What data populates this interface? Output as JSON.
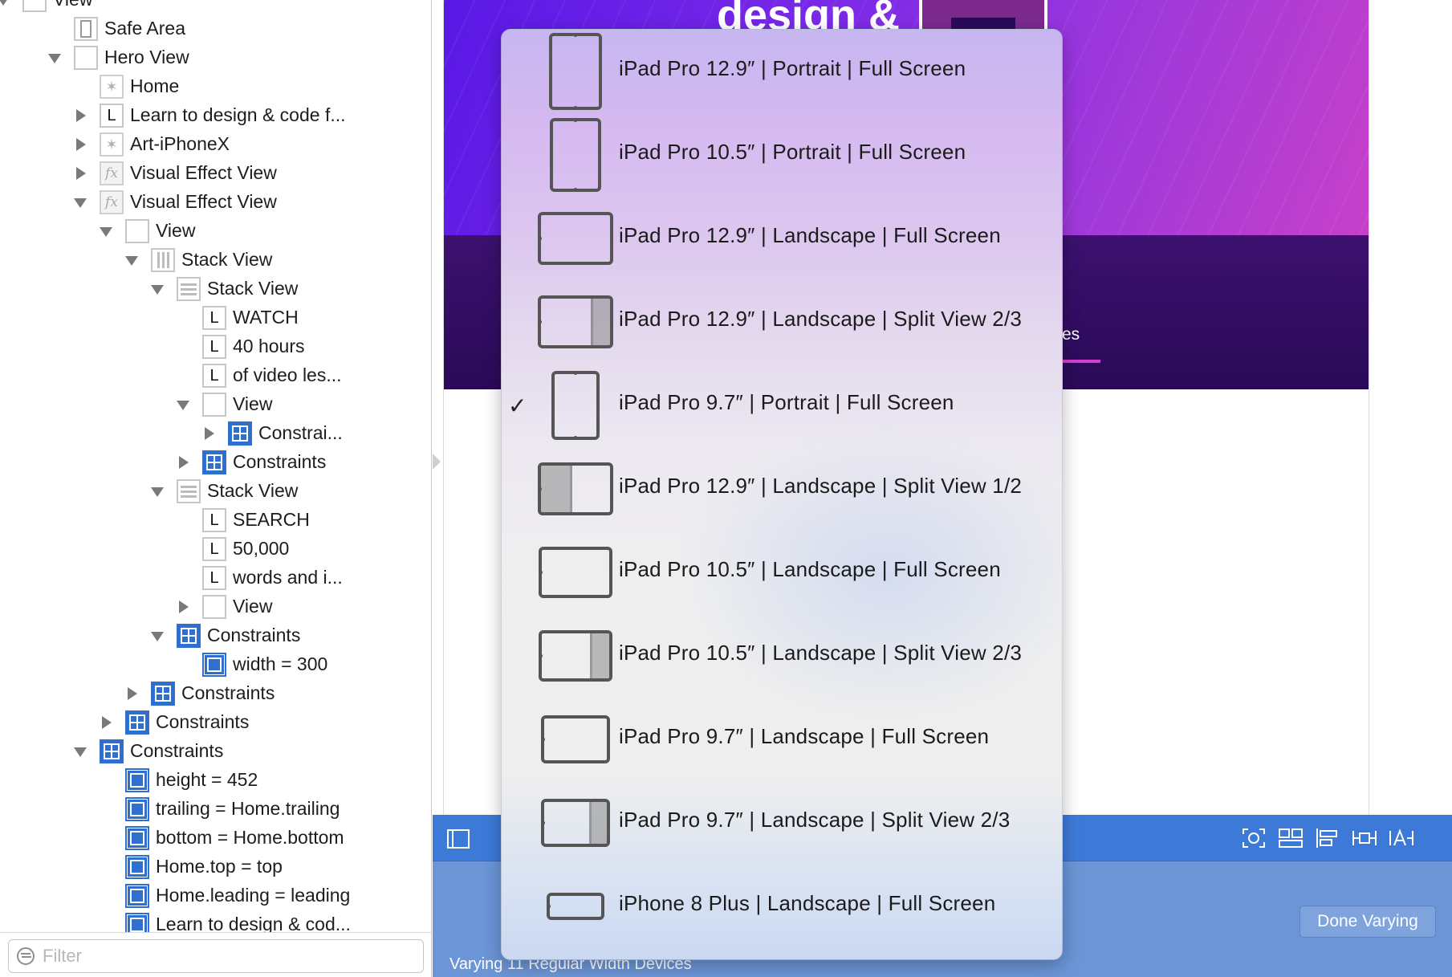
{
  "outline": {
    "rows": [
      {
        "label": "View",
        "icon": "view-icon",
        "expanded": true
      },
      {
        "label": "Safe Area",
        "icon": "safe-area-icon"
      },
      {
        "label": "Hero View",
        "icon": "view-icon",
        "expanded": true
      },
      {
        "label": "Home",
        "icon": "image-view-icon"
      },
      {
        "label": "Learn to design & code f...",
        "icon": "label-icon",
        "expanded": false
      },
      {
        "label": "Art-iPhoneX",
        "icon": "image-view-icon",
        "expanded": false
      },
      {
        "label": "Visual Effect View",
        "icon": "visual-effect-icon",
        "expanded": false
      },
      {
        "label": "Visual Effect View",
        "icon": "visual-effect-icon",
        "expanded": true
      },
      {
        "label": "View",
        "icon": "view-icon",
        "expanded": true
      },
      {
        "label": "Stack View",
        "icon": "horizontal-stack-icon",
        "expanded": true
      },
      {
        "label": "Stack View",
        "icon": "vertical-stack-icon",
        "expanded": true
      },
      {
        "label": "WATCH",
        "icon": "label-icon"
      },
      {
        "label": "40 hours",
        "icon": "label-icon"
      },
      {
        "label": "of video les...",
        "icon": "label-icon"
      },
      {
        "label": "View",
        "icon": "view-icon",
        "expanded": true
      },
      {
        "label": "Constrai...",
        "icon": "constraints-icon",
        "expanded": false
      },
      {
        "label": "Constraints",
        "icon": "constraints-icon",
        "expanded": false
      },
      {
        "label": "Stack View",
        "icon": "vertical-stack-icon",
        "expanded": true
      },
      {
        "label": "SEARCH",
        "icon": "label-icon"
      },
      {
        "label": "50,000",
        "icon": "label-icon"
      },
      {
        "label": "words and i...",
        "icon": "label-icon"
      },
      {
        "label": "View",
        "icon": "view-icon",
        "expanded": false
      },
      {
        "label": "Constraints",
        "icon": "constraints-icon",
        "expanded": true
      },
      {
        "label": "width = 300",
        "icon": "width-constraint-icon"
      },
      {
        "label": "Constraints",
        "icon": "constraints-icon",
        "expanded": false
      },
      {
        "label": "Constraints",
        "icon": "constraints-icon",
        "expanded": false
      },
      {
        "label": "Constraints",
        "icon": "constraints-icon",
        "expanded": true
      },
      {
        "label": "height = 452",
        "icon": "height-constraint-icon"
      },
      {
        "label": "trailing = Home.trailing",
        "icon": "trailing-constraint-icon"
      },
      {
        "label": "bottom = Home.bottom",
        "icon": "bottom-constraint-icon"
      },
      {
        "label": "Home.top = top",
        "icon": "top-constraint-icon"
      },
      {
        "label": "Home.leading = leading",
        "icon": "leading-constraint-icon"
      },
      {
        "label": "Learn to design & cod...",
        "icon": "center-constraint-icon"
      }
    ],
    "label_glyph": "L",
    "filter_placeholder": "Filter"
  },
  "canvas": {
    "hero_title": "design &",
    "band_tab_text": "es",
    "hero_colors": [
      "#5a18e6",
      "#c640c9"
    ],
    "band_color": "#2a0a58"
  },
  "device_menu": {
    "items": [
      {
        "label": "iPad Pro 12.9″ | Portrait | Full Screen",
        "icon": "ipad-portrait-icon",
        "checked": false
      },
      {
        "label": "iPad Pro 10.5″ | Portrait | Full Screen",
        "icon": "ipad-portrait-icon",
        "checked": false
      },
      {
        "label": "iPad Pro 12.9″ | Landscape | Full Screen",
        "icon": "ipad-landscape-icon",
        "checked": false
      },
      {
        "label": "iPad Pro 12.9″ | Landscape | Split View 2/3",
        "icon": "ipad-landscape-split-two-thirds-icon",
        "checked": false
      },
      {
        "label": "iPad Pro 9.7″ | Portrait | Full Screen",
        "icon": "ipad-portrait-icon",
        "checked": true
      },
      {
        "label": "iPad Pro 12.9″ | Landscape | Split View 1/2",
        "icon": "ipad-landscape-split-half-icon",
        "checked": false
      },
      {
        "label": "iPad Pro 10.5″ | Landscape | Full Screen",
        "icon": "ipad-landscape-icon",
        "checked": false
      },
      {
        "label": "iPad Pro 10.5″ | Landscape | Split View 2/3",
        "icon": "ipad-landscape-split-two-thirds-icon",
        "checked": false
      },
      {
        "label": "iPad Pro 9.7″ | Landscape | Full Screen",
        "icon": "ipad-landscape-icon",
        "checked": false
      },
      {
        "label": "iPad Pro 9.7″ | Landscape | Split View 2/3",
        "icon": "ipad-landscape-split-two-thirds-icon",
        "checked": false
      },
      {
        "label": "iPhone 8 Plus | Landscape | Full Screen",
        "icon": "iphone-landscape-icon",
        "checked": false
      }
    ],
    "check_glyph": "✓"
  },
  "vary_bar": {
    "status": "Varying 11 Regular Width Devices",
    "done_label": "Done Varying",
    "accent": "#3d7ad8",
    "toolbar_icons": [
      "update-frames-icon",
      "embed-in-stack-icon",
      "align-icon",
      "add-constraints-icon",
      "resolve-issues-icon"
    ]
  }
}
